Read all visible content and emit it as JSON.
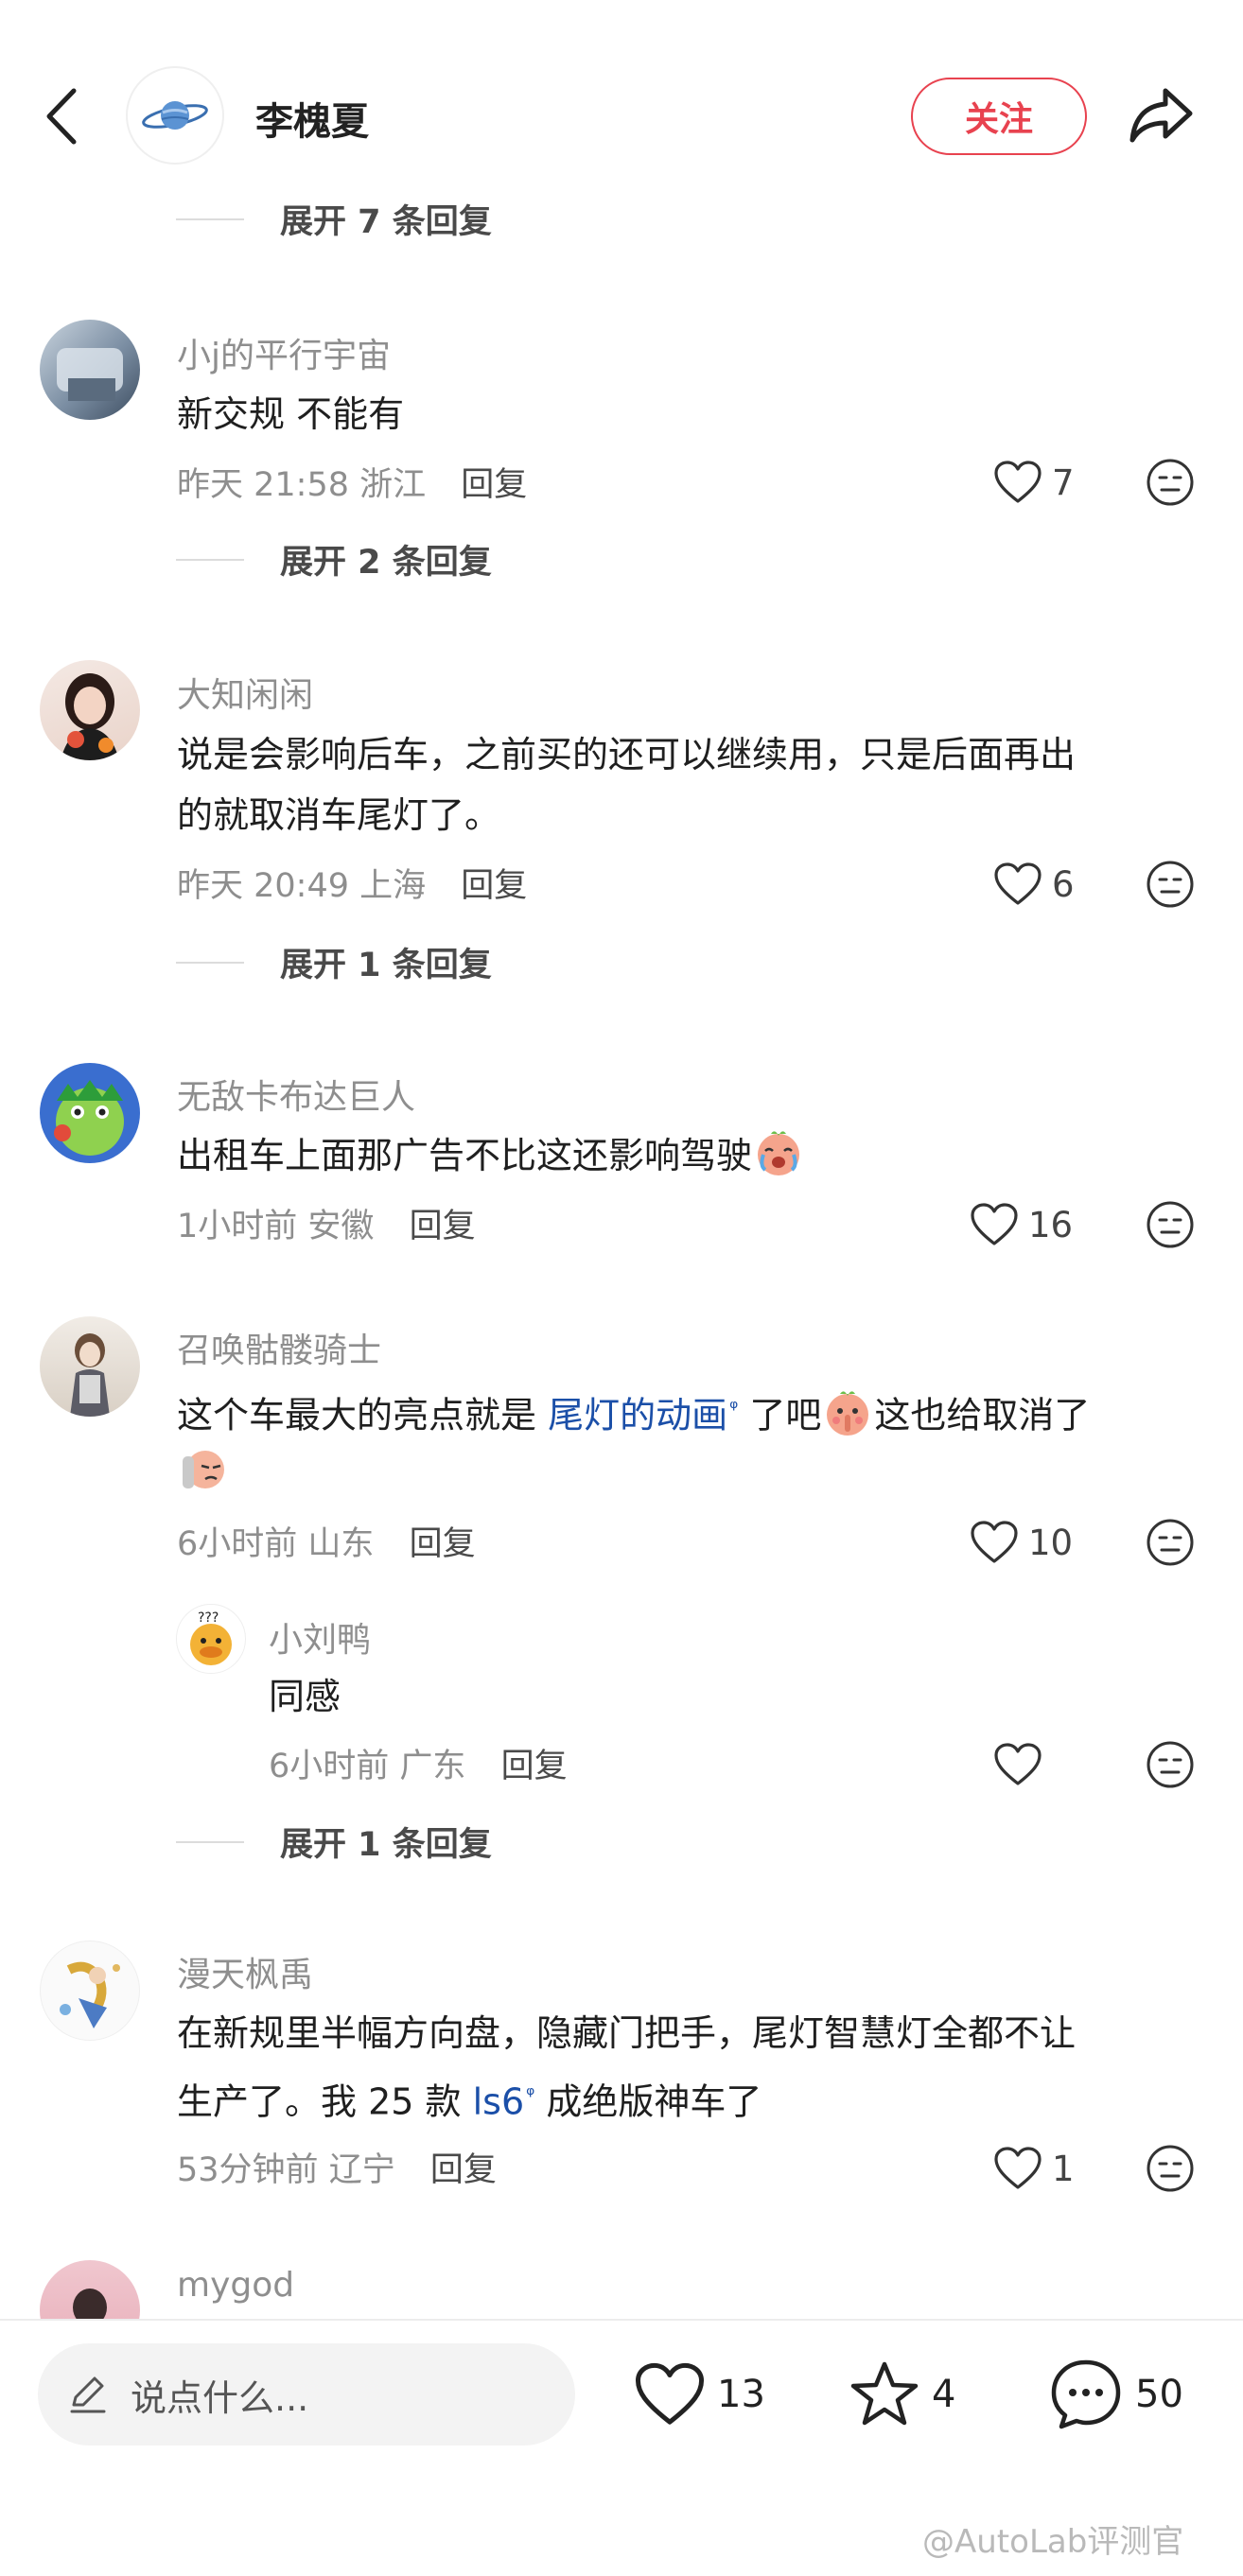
{
  "header": {
    "author": "李槐夏",
    "follow_label": "关注"
  },
  "expand_top": "展开 7 条回复",
  "comments": [
    {
      "username": "小j的平行宇宙",
      "content": "新交规 不能有",
      "time": "昨天 21:58",
      "location": "浙江",
      "reply_label": "回复",
      "likes": "7",
      "expand": "展开 2 条回复"
    },
    {
      "username": "大知闲闲",
      "content_line1": "说是会影响后车，之前买的还可以继续用，只是后面再出",
      "content_line2": "的就取消车尾灯了。",
      "time": "昨天 20:49",
      "location": "上海",
      "reply_label": "回复",
      "likes": "6",
      "expand": "展开 1 条回复"
    },
    {
      "username": "无敌卡布达巨人",
      "content": "出租车上面那广告不比这还影响驾驶",
      "time": "1小时前",
      "location": "安徽",
      "reply_label": "回复",
      "likes": "16"
    },
    {
      "username": "召唤骷髅骑士",
      "content_pre": "这个车最大的亮点就是 ",
      "content_link": "尾灯的动画",
      "content_post": " 了吧",
      "content_tail": "这也给取消了",
      "time": "6小时前",
      "location": "山东",
      "reply_label": "回复",
      "likes": "10",
      "sub_reply": {
        "username": "小刘鸭",
        "content": "同感",
        "time": "6小时前",
        "location": "广东",
        "reply_label": "回复"
      },
      "expand": "展开 1 条回复"
    },
    {
      "username": "漫天枫禹",
      "content_line1": "在新规里半幅方向盘，隐藏门把手，尾灯智慧灯全都不让",
      "content_line2_pre": "生产了。我 25 款 ",
      "content_line2_link": "ls6",
      "content_line2_post": " 成绝版神车了",
      "time": "53分钟前",
      "location": "辽宁",
      "reply_label": "回复",
      "likes": "1"
    },
    {
      "username": "mygod"
    }
  ],
  "bottom_bar": {
    "placeholder": "说点什么...",
    "likes": "13",
    "stars": "4",
    "comments": "50"
  },
  "watermark": "@AutoLab评测官",
  "colors": {
    "accent": "#e8424f",
    "link": "#1b4fa8",
    "muted": "#8e8e8e"
  },
  "icons": [
    "back-icon",
    "planet-icon",
    "share-icon",
    "heart-icon",
    "meh-face-icon",
    "pen-icon",
    "star-icon",
    "chat-bubble-icon"
  ]
}
